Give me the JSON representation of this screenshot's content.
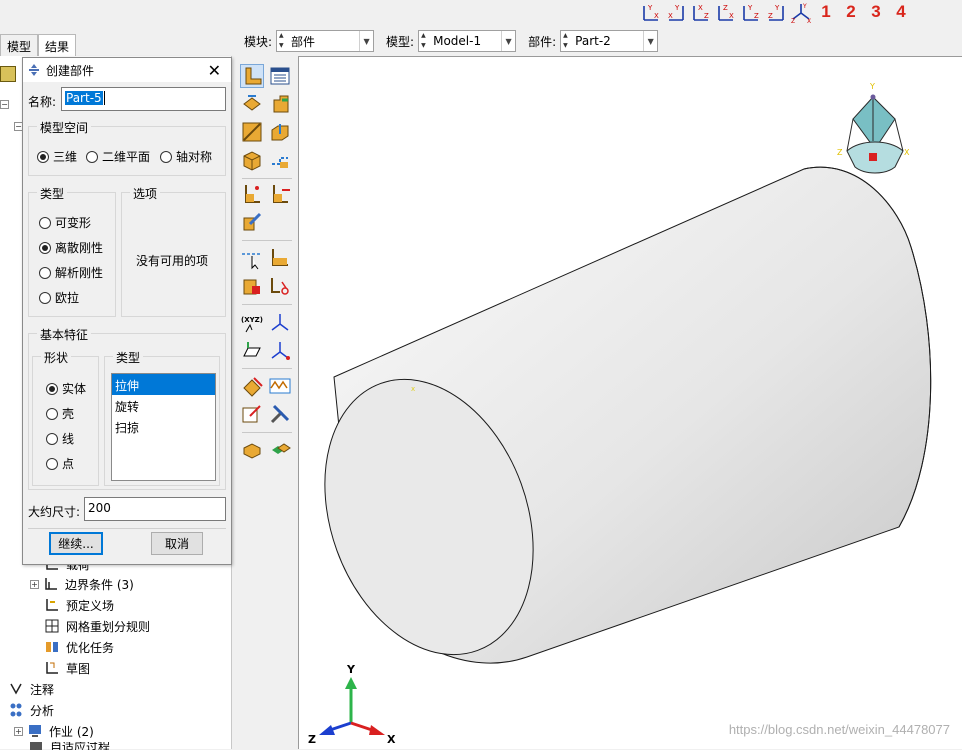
{
  "view_toolbar": {
    "axis_icons": [
      "view-front-icon",
      "view-back-icon",
      "view-top-icon",
      "view-bottom-icon",
      "view-left-icon",
      "view-right-icon",
      "view-iso-icon"
    ],
    "numbers": [
      "1",
      "2",
      "3",
      "4"
    ]
  },
  "context_bar": {
    "module_label": "模块:",
    "module_value": "部件",
    "model_label": "模型:",
    "model_value": "Model-1",
    "part_label": "部件:",
    "part_value": "Part-2"
  },
  "tabs": [
    {
      "label": "模型"
    },
    {
      "label": "结果"
    }
  ],
  "tree": {
    "items": [
      {
        "label": "载荷"
      },
      {
        "label": "边界条件 (3)"
      },
      {
        "label": "预定义场"
      },
      {
        "label": "网格重划分规则"
      },
      {
        "label": "优化任务"
      },
      {
        "label": "草图"
      },
      {
        "label": "注释"
      },
      {
        "label": "分析"
      },
      {
        "label": "作业 (2)"
      },
      {
        "label": "自适应过程"
      }
    ]
  },
  "dialog": {
    "title": "创建部件",
    "close_glyph": "✕",
    "name_label": "名称:",
    "name_value": "Part-5",
    "model_space": {
      "title": "模型空间",
      "options": [
        "三维",
        "二维平面",
        "轴对称"
      ],
      "selected": "三维"
    },
    "type": {
      "title": "类型",
      "options": [
        "可变形",
        "离散刚性",
        "解析刚性",
        "欧拉"
      ],
      "selected": "离散刚性"
    },
    "options_group": {
      "title": "选项",
      "empty_text": "没有可用的项"
    },
    "base_feature": {
      "title": "基本特征",
      "shape_title": "形状",
      "shapes": [
        "实体",
        "壳",
        "线",
        "点"
      ],
      "selected_shape": "实体",
      "type_title": "类型",
      "types": [
        "拉伸",
        "旋转",
        "扫掠"
      ],
      "selected_type": "拉伸"
    },
    "approx_size_label": "大约尺寸:",
    "approx_size_value": "200",
    "continue_label": "继续...",
    "cancel_label": "取消"
  },
  "viewport": {
    "triad_labels": {
      "y": "Y",
      "z": "Z",
      "x": "X"
    },
    "watermark": "https://blog.csdn.net/weixin_44478077"
  },
  "colors": {
    "accent": "#0078d7",
    "view_numbers": "#d9261c",
    "triad_y": "#2db44a",
    "triad_z": "#1c3fcf",
    "triad_x": "#d92020"
  }
}
